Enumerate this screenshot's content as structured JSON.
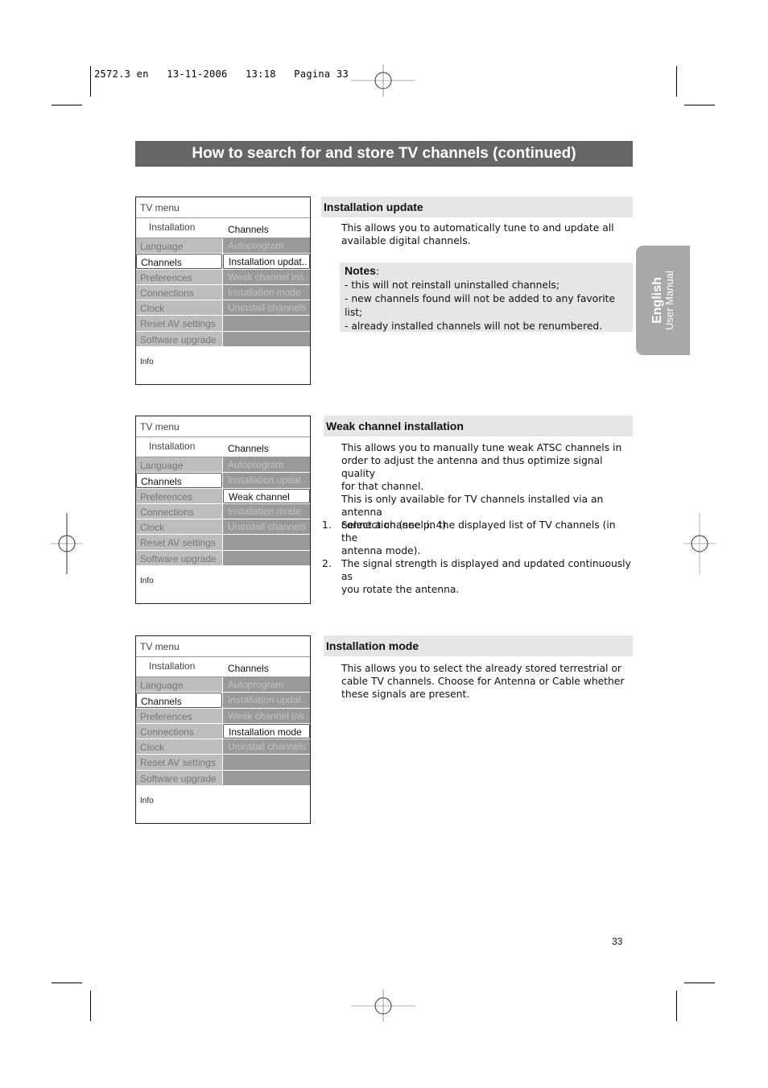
{
  "slug": "2572.3 en   13-11-2006   13:18   Pagina 33",
  "page_title": "How to search for and store TV channels (continued)",
  "language_tab": {
    "language": "English",
    "subtitle": "User Manual"
  },
  "menus": [
    {
      "header": "TV menu",
      "sub_left": "Installation",
      "sub_right": "Channels",
      "left_items": [
        "Language",
        "Channels",
        "Preferences",
        "Connections",
        "Clock",
        "Reset AV settings",
        "Software upgrade"
      ],
      "right_items": [
        "Autoprogram",
        "Installation updat..",
        "Weak channel ins..",
        "Installation mode",
        "Uninstall channels",
        "",
        ""
      ],
      "selected_left": 1,
      "selected_right": 1,
      "info": "Info"
    },
    {
      "header": "TV menu",
      "sub_left": "Installation",
      "sub_right": "Channels",
      "left_items": [
        "Language",
        "Channels",
        "Preferences",
        "Connections",
        "Clock",
        "Reset AV settings",
        "Software upgrade"
      ],
      "right_items": [
        "Autoprogram",
        "Installation updat..",
        "Weak channel ins..",
        "Installation mode",
        "Uninstall channels",
        "",
        ""
      ],
      "selected_left": 1,
      "selected_right": 2,
      "info": "Info"
    },
    {
      "header": "TV menu",
      "sub_left": "Installation",
      "sub_right": "Channels",
      "left_items": [
        "Language",
        "Channels",
        "Preferences",
        "Connections",
        "Clock",
        "Reset AV settings",
        "Software upgrade"
      ],
      "right_items": [
        "Autoprogram",
        "Installation updat..",
        "Weak channel ins..",
        "Installation mode",
        "Uninstall channels",
        "",
        ""
      ],
      "selected_left": 1,
      "selected_right": 3,
      "info": "Info"
    }
  ],
  "sections": {
    "installation_update": {
      "heading": "Installation update",
      "body": [
        "This allows you to automatically tune to and update all",
        "available digital channels."
      ],
      "notes_label": "Notes",
      "notes_colon": ":",
      "notes": [
        "- this will not reinstall uninstalled channels;",
        "- new channels found will not be added to any favorite list;",
        "- already installed channels will not be renumbered."
      ]
    },
    "weak_channel": {
      "heading": "Weak channel installation",
      "body": [
        "This allows you to manually tune weak ATSC channels in",
        "order to adjust the antenna and thus optimize signal quality",
        "for that channel.",
        "This is only available for TV channels installed via an antenna",
        "connection (see p. 4)."
      ],
      "steps": [
        {
          "num": "1.",
          "lines": [
            "Select a channel in the displayed list of TV channels (in the",
            "antenna mode)."
          ]
        },
        {
          "num": "2.",
          "lines": [
            "The signal strength is displayed and updated continuously as",
            "you rotate the antenna."
          ]
        }
      ]
    },
    "installation_mode": {
      "heading": "Installation mode",
      "body": [
        "This allows you to select the already stored terrestrial or",
        "cable TV channels. Choose for Antenna or Cable whether",
        "these signals are present."
      ]
    }
  },
  "page_number": "33",
  "colors": {
    "title_bar": "#666666",
    "section_head": "#e6e6e6",
    "lang_tab": "#a8a8a8",
    "menu_left": "#bdbdbd",
    "menu_right": "#9a9a9a"
  }
}
